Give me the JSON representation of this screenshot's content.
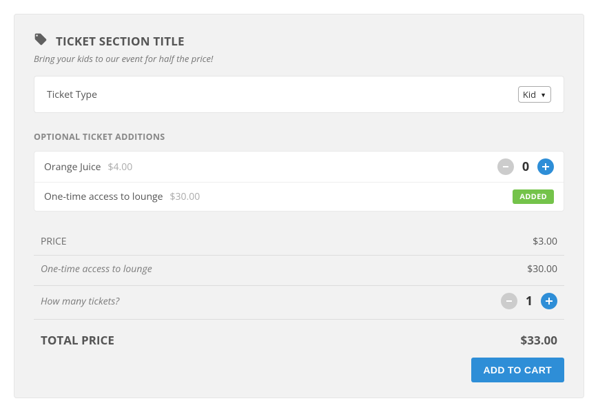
{
  "header": {
    "title": "TICKET SECTION TITLE",
    "subtitle": "Bring your kids to our event for half the price!"
  },
  "ticketType": {
    "label": "Ticket Type",
    "selected": "Kid"
  },
  "additions": {
    "heading": "OPTIONAL TICKET ADDITIONS",
    "items": [
      {
        "name": "Orange Juice",
        "price": "$4.00",
        "qty": "0",
        "mode": "stepper"
      },
      {
        "name": "One-time access to lounge",
        "price": "$30.00",
        "badge": "ADDED",
        "mode": "badge"
      }
    ]
  },
  "pricing": {
    "priceLabel": "PRICE",
    "priceValue": "$3.00",
    "lineItems": [
      {
        "label": "One-time access to lounge",
        "value": "$30.00"
      }
    ]
  },
  "quantity": {
    "label": "How many tickets?",
    "value": "1"
  },
  "total": {
    "label": "TOTAL PRICE",
    "value": "$33.00"
  },
  "actions": {
    "addToCart": "ADD TO CART"
  }
}
